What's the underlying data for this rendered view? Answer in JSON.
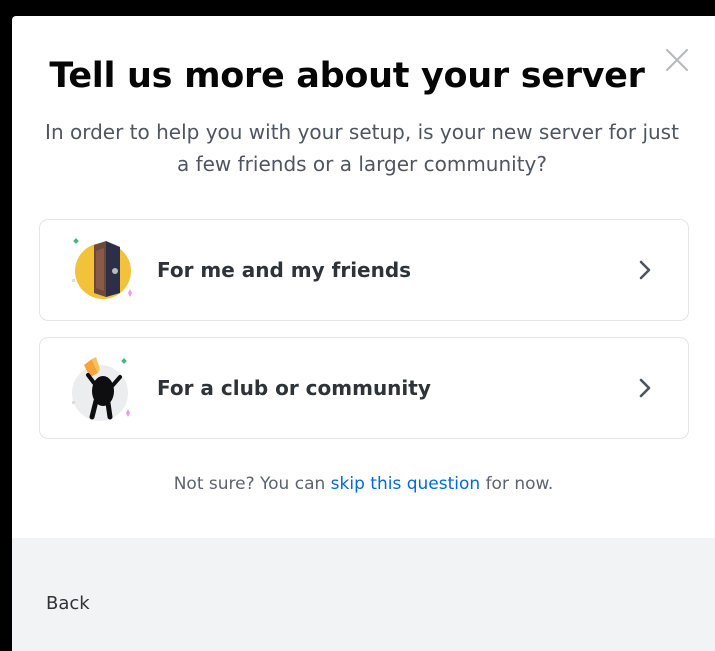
{
  "modal": {
    "title": "Tell us more about your server",
    "subtitle": "In order to help you with your setup, is your new server for just a few friends or a larger community?",
    "close_icon": "close-icon"
  },
  "options": [
    {
      "label": "For me and my friends",
      "icon": "door-illustration",
      "chevron": "chevron-right-icon"
    },
    {
      "label": "For a club or community",
      "icon": "community-illustration",
      "chevron": "chevron-right-icon"
    }
  ],
  "footnote": {
    "prefix": "Not sure? You can ",
    "link": "skip this question",
    "suffix": " for now."
  },
  "footer": {
    "back_label": "Back"
  },
  "colors": {
    "link": "#0068e0",
    "title": "#060607",
    "footer_bg": "#f2f3f5",
    "yellow": "#f2c33a"
  }
}
